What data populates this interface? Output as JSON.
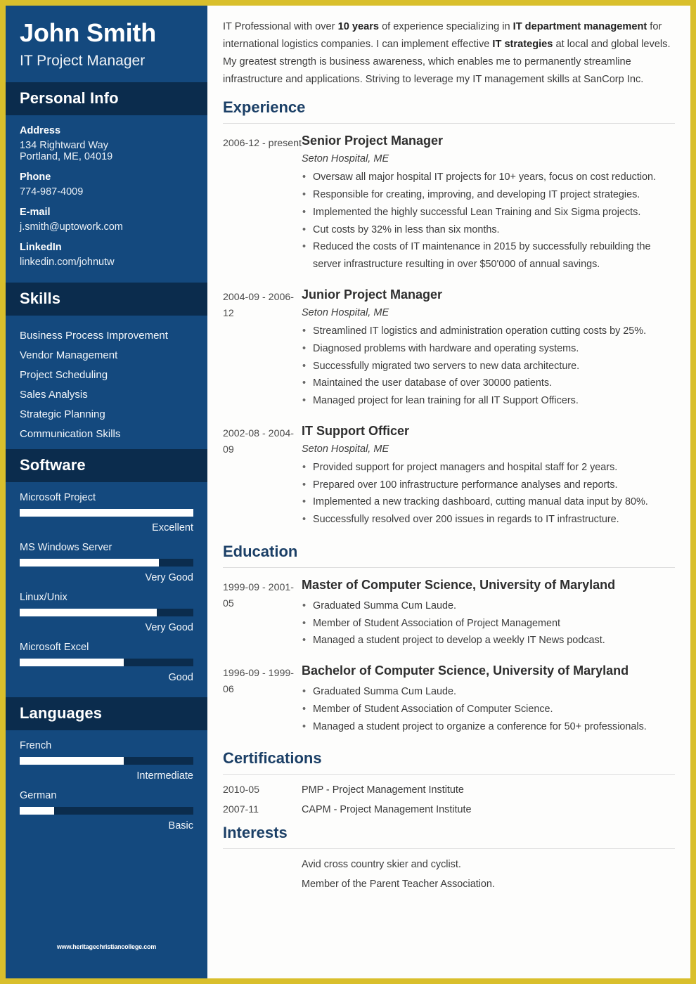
{
  "colors": {
    "border_gold": "#d9bf2c",
    "sidebar_blue": "#14497e",
    "section_band_navy": "#0b2c4d",
    "heading_navy": "#1b3f66",
    "bar_fill": "#ffffff"
  },
  "sidebar": {
    "full_name": "John Smith",
    "job_title": "IT Project Manager",
    "personal_info": {
      "heading": "Personal Info",
      "fields": [
        {
          "label": "Address",
          "value": "134 Rightward Way",
          "value2": "Portland, ME, 04019"
        },
        {
          "label": "Phone",
          "value": "774-987-4009"
        },
        {
          "label": "E-mail",
          "value": "j.smith@uptowork.com"
        },
        {
          "label": "LinkedIn",
          "value": "linkedin.com/johnutw"
        }
      ]
    },
    "skills": {
      "heading": "Skills",
      "items": [
        "Business Process Improvement",
        "Vendor Management",
        "Project Scheduling",
        "Sales Analysis",
        "Strategic Planning",
        "Communication Skills"
      ]
    },
    "software": {
      "heading": "Software",
      "items": [
        {
          "name": "Microsoft Project",
          "level": "Excellent",
          "percent": 100
        },
        {
          "name": "MS Windows Server",
          "level": "Very Good",
          "percent": 80
        },
        {
          "name": "Linux/Unix",
          "level": "Very Good",
          "percent": 79
        },
        {
          "name": "Microsoft Excel",
          "level": "Good",
          "percent": 60
        }
      ]
    },
    "languages": {
      "heading": "Languages",
      "items": [
        {
          "name": "French",
          "level": "Intermediate",
          "percent": 60
        },
        {
          "name": "German",
          "level": "Basic",
          "percent": 20
        }
      ]
    },
    "watermark": "www.heritagechristiancollege.com"
  },
  "main": {
    "summary": {
      "part1": "IT Professional with over ",
      "bold1": "10 years",
      "part2": " of experience specializing in ",
      "bold2": "IT department management",
      "part3": " for international logistics companies. I can implement effective ",
      "bold3": "IT strategies",
      "part4": " at local and global levels. My greatest strength is business awareness, which enables me to permanently streamline infrastructure and applications. Striving to leverage my IT management skills at SanCorp Inc."
    },
    "experience": {
      "heading": "Experience",
      "entries": [
        {
          "dates": "2006-12 - present",
          "title": "Senior Project Manager",
          "subtitle": "Seton Hospital, ME",
          "bullets": [
            "Oversaw all major hospital IT projects for 10+ years, focus on cost reduction.",
            "Responsible for creating, improving, and developing IT project strategies.",
            "Implemented the highly successful Lean Training and Six Sigma projects.",
            "Cut costs by 32% in less than six months.",
            "Reduced the costs of IT maintenance in 2015 by successfully rebuilding the server infrastructure resulting in over $50'000 of annual savings."
          ]
        },
        {
          "dates": "2004-09 - 2006-12",
          "title": "Junior Project Manager",
          "subtitle": "Seton Hospital, ME",
          "bullets": [
            "Streamlined IT logistics and administration operation cutting costs by 25%.",
            "Diagnosed problems with hardware and operating systems.",
            "Successfully migrated two servers to new data architecture.",
            "Maintained the user database of over 30000 patients.",
            "Managed project for lean training for all IT Support Officers."
          ]
        },
        {
          "dates": "2002-08 - 2004-09",
          "title": "IT Support Officer",
          "subtitle": "Seton Hospital, ME",
          "bullets": [
            "Provided support for project managers and hospital staff for 2 years.",
            "Prepared over 100 infrastructure performance analyses and reports.",
            "Implemented a new tracking dashboard, cutting manual data input by 80%.",
            "Successfully resolved over 200 issues in regards to IT infrastructure."
          ]
        }
      ]
    },
    "education": {
      "heading": "Education",
      "entries": [
        {
          "dates": "1999-09 - 2001-05",
          "title": "Master of Computer Science, University of Maryland",
          "bullets": [
            "Graduated Summa Cum Laude.",
            "Member of Student Association of Project Management",
            "Managed a student project to develop a weekly IT News podcast."
          ]
        },
        {
          "dates": "1996-09 - 1999-06",
          "title": "Bachelor of Computer Science, University of Maryland",
          "bullets": [
            "Graduated Summa Cum Laude.",
            "Member of Student Association of Computer Science.",
            "Managed a student project to organize a conference for 50+ professionals."
          ]
        }
      ]
    },
    "certifications": {
      "heading": "Certifications",
      "rows": [
        {
          "date": "2010-05",
          "text": "PMP - Project Management Institute"
        },
        {
          "date": "2007-11",
          "text": "CAPM - Project Management Institute"
        }
      ]
    },
    "interests": {
      "heading": "Interests",
      "rows": [
        "Avid cross country skier and cyclist.",
        "Member of the Parent Teacher Association."
      ]
    }
  }
}
